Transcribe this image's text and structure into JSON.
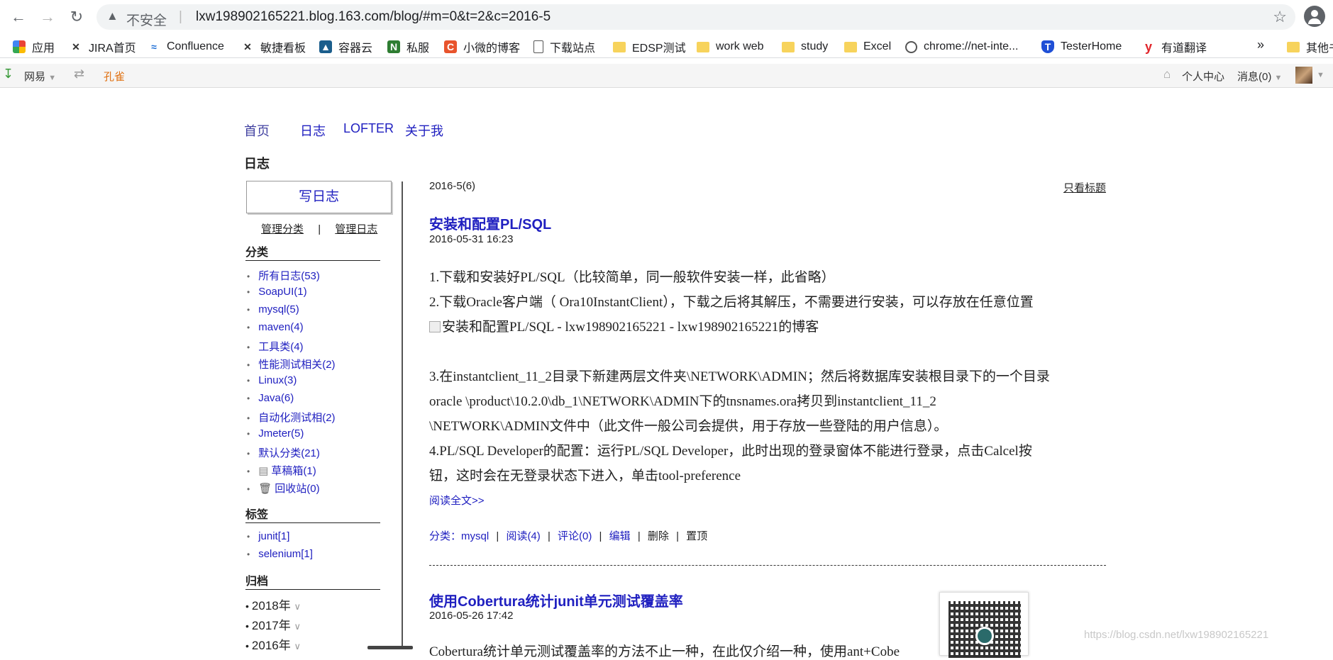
{
  "browser": {
    "insecure_label": "不安全",
    "url": "lxw198902165221.blog.163.com/blog/#m=0&t=2&c=2016-5"
  },
  "bookmarks": [
    {
      "label": "应用",
      "icon": "apps-grid-icon"
    },
    {
      "label": "JIRA首页",
      "icon": "jira-icon"
    },
    {
      "label": "Confluence",
      "icon": "confluence-icon"
    },
    {
      "label": "敏捷看板",
      "icon": "jira-icon"
    },
    {
      "label": "容器云",
      "icon": "cloud-icon"
    },
    {
      "label": "私服",
      "icon": "nexus-icon"
    },
    {
      "label": "小微的博客",
      "icon": "blog-icon"
    },
    {
      "label": "下载站点",
      "icon": "page-icon"
    },
    {
      "label": "EDSP测试",
      "icon": "folder-icon"
    },
    {
      "label": "work web",
      "icon": "folder-icon"
    },
    {
      "label": "study",
      "icon": "folder-icon"
    },
    {
      "label": "Excel",
      "icon": "folder-icon"
    },
    {
      "label": "chrome://net-inte...",
      "icon": "globe-icon"
    },
    {
      "label": "TesterHome",
      "icon": "testerhome-icon"
    },
    {
      "label": "有道翻译",
      "icon": "youdao-icon"
    }
  ],
  "bookmarks_more": "»",
  "bookmarks_other": "其他书",
  "netease_bar": {
    "netease": "网易",
    "kongque": "孔雀",
    "personal_center": "个人中心",
    "messages": "消息(0)"
  },
  "topnav": [
    "首页",
    "日志",
    "LOFTER",
    "关于我"
  ],
  "page_heading": "日志",
  "sidebar": {
    "write_button": "写日志",
    "manage_category": "管理分类",
    "separator": "|",
    "manage_log": "管理日志",
    "category_heading": "分类",
    "categories": [
      "所有日志(53)",
      "SoapUI(1)",
      "mysql(5)",
      "maven(4)",
      "工具类(4)",
      "性能测试相关(2)",
      "Linux(3)",
      "Java(6)",
      "自动化测试相(2)",
      "Jmeter(5)",
      "默认分类(21)",
      "草稿箱(1)",
      "回收站(0)"
    ],
    "tags_heading": "标签",
    "tags": [
      "junit[1]",
      "selenium[1]"
    ],
    "archive_heading": "归档",
    "years": [
      "2018年",
      "2017年",
      "2016年"
    ]
  },
  "main": {
    "month_label": "2016-5(6)",
    "titles_only": "只看标题",
    "post1": {
      "title": "安装和配置PL/SQL",
      "date": "2016-05-31 16:23",
      "lines": [
        "1.下载和安装好PL/SQL（比较简单，同一般软件安装一样，此省略）",
        "2.下载Oracle客户端（ Ora10InstantClient），下载之后将其解压，不需要进行安装，可以存放在任意位置",
        "安装和配置PL/SQL - lxw198902165221 - lxw198902165221的博客",
        "3.在instantclient_11_2目录下新建两层文件夹\\NETWORK\\ADMIN；然后将数据库安装根目录下的一个目录",
        "oracle \\product\\10.2.0\\db_1\\NETWORK\\ADMIN下的tnsnames.ora拷贝到instantclient_11_2",
        "\\NETWORK\\ADMIN文件中（此文件一般公司会提供，用于存放一些登陆的用户信息）。",
        "4.PL/SQL Developer的配置：运行PL/SQL Developer，此时出现的登录窗体不能进行登录，点击Calcel按",
        "钮，这时会在无登录状态下进入，单击tool-preference"
      ],
      "read_more": "阅读全文>>",
      "meta": {
        "category_label": "分类：",
        "category": "mysql",
        "sep": "|",
        "reads": "阅读(4)",
        "comments": "评论(0)",
        "edit": "编辑",
        "delete": "删除",
        "pin": "置顶"
      }
    },
    "post2": {
      "title": "使用Cobertura统计junit单元测试覆盖率",
      "date": "2016-05-26 17:42",
      "snippet": "Cobertura统计单元测试覆盖率的方法不止一种，在此仅介绍一种，使用ant+Cobe"
    }
  },
  "watermark": "https://blog.csdn.net/lxw198902165221"
}
